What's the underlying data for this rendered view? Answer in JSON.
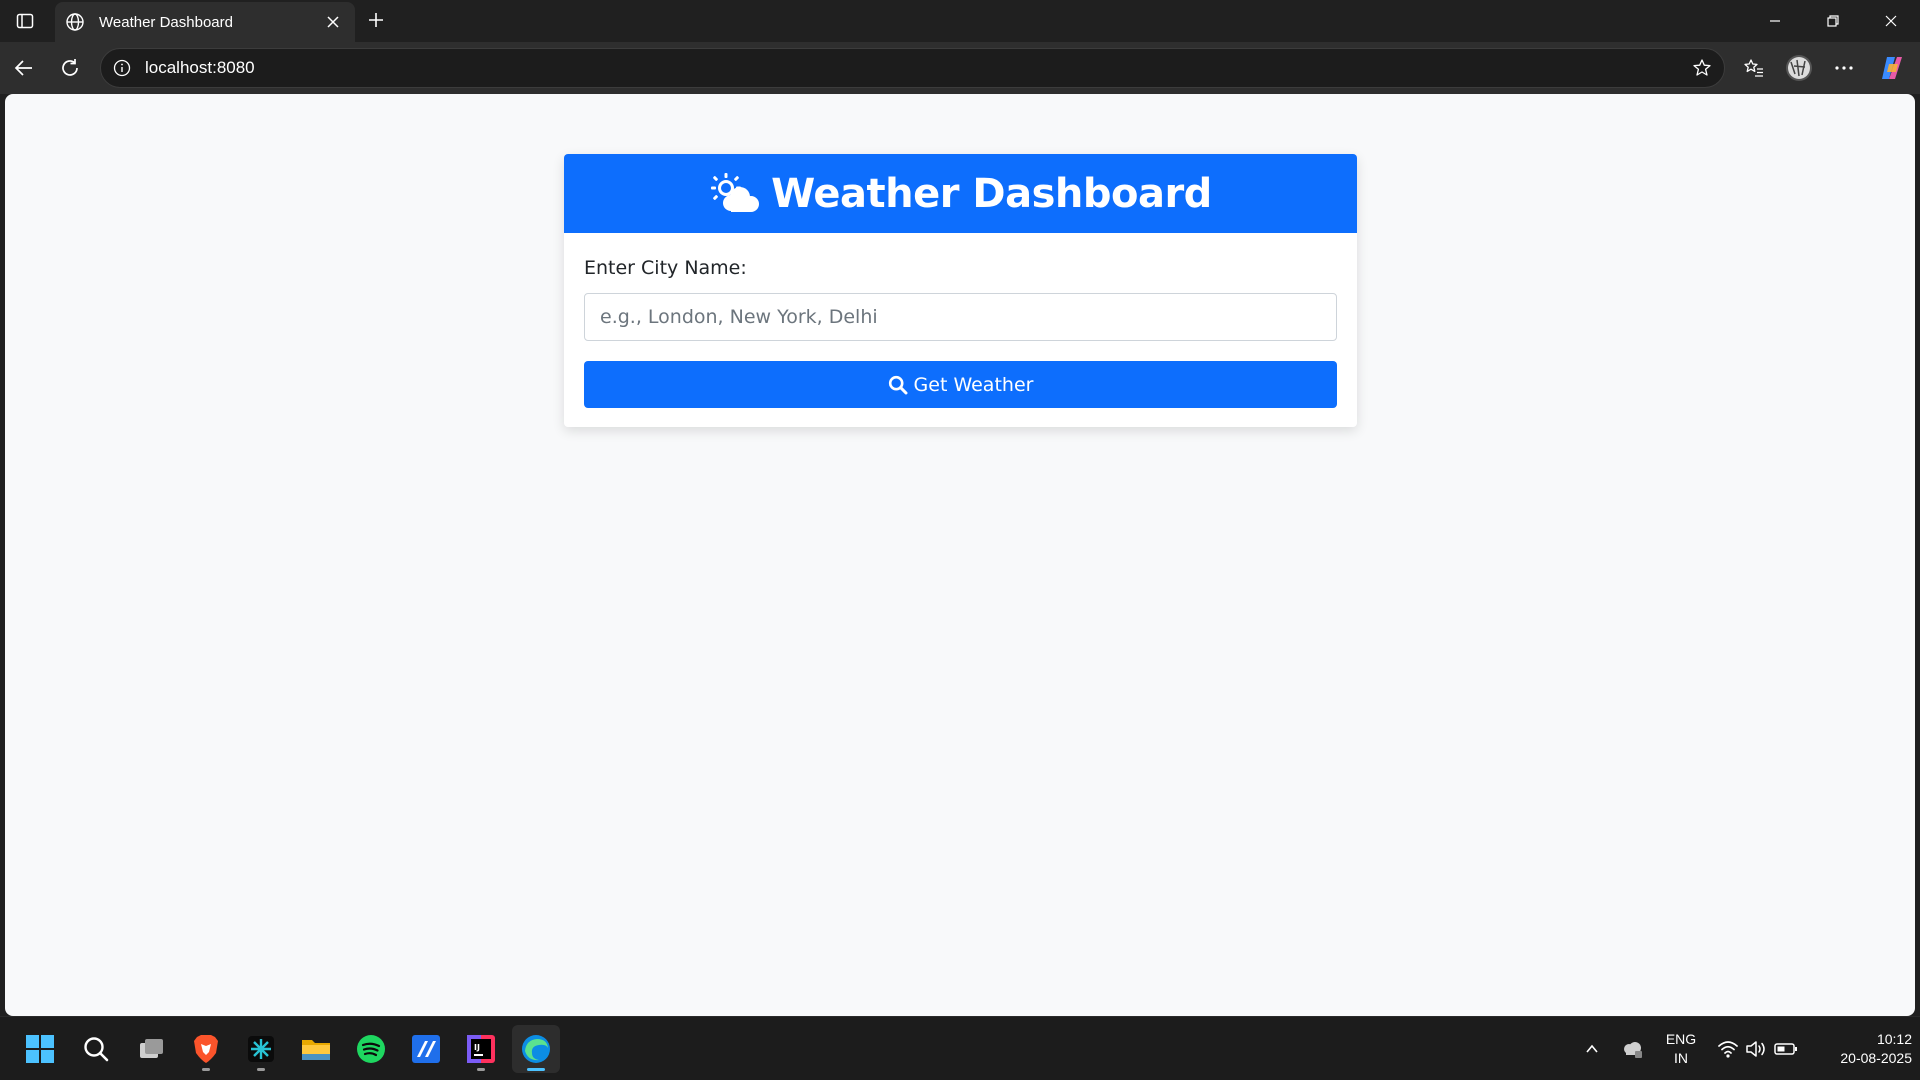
{
  "browser": {
    "tab_title": "Weather Dashboard",
    "url": "localhost:8080"
  },
  "page": {
    "header_title": "Weather Dashboard",
    "city_label": "Enter City Name:",
    "city_placeholder": "e.g., London, New York, Delhi",
    "city_value": "",
    "button_label": "Get Weather",
    "accent_color": "#0d6efd",
    "background_color": "#f8f9fa"
  },
  "taskbar": {
    "apps": [
      "start-icon",
      "search-icon",
      "task-view-icon",
      "brave-browser-icon",
      "app-icon",
      "file-explorer-icon",
      "spotify-icon",
      "app-icon",
      "intellij-icon",
      "edge-icon"
    ],
    "language_line1": "ENG",
    "language_line2": "IN",
    "time": "10:12",
    "date": "20-08-2025"
  }
}
